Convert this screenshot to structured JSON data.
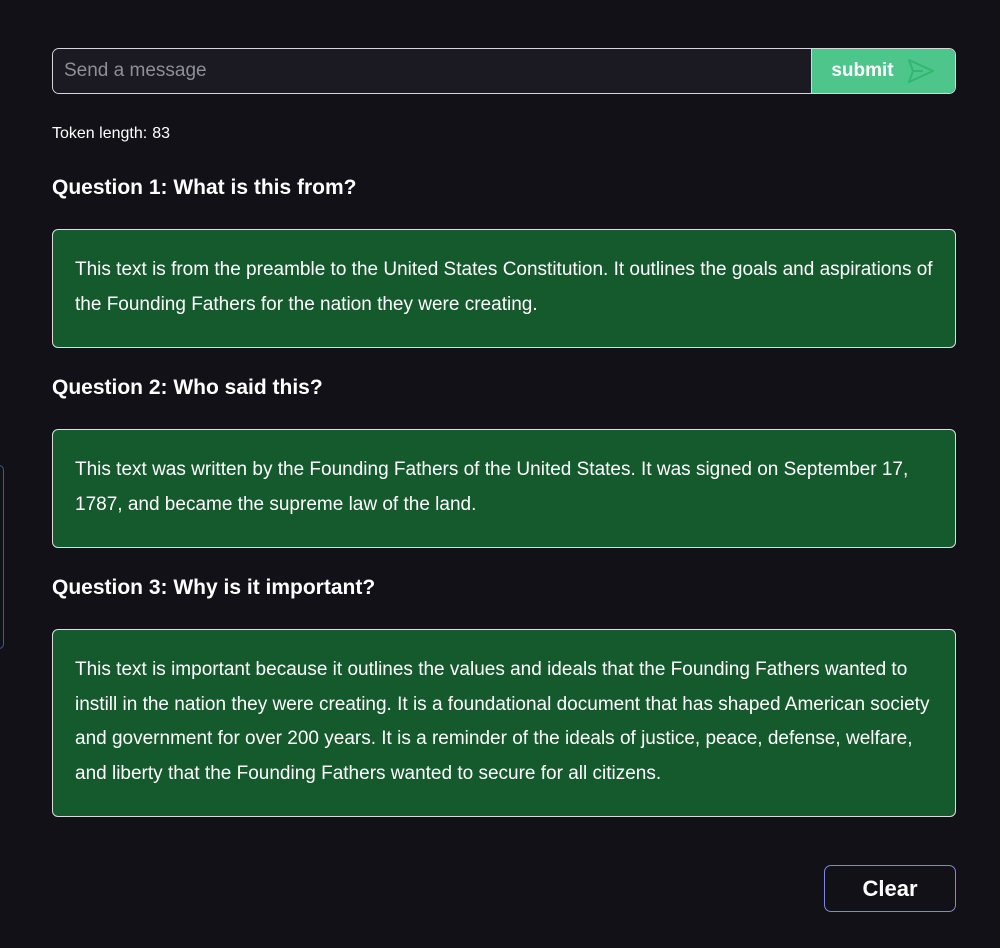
{
  "input": {
    "placeholder": "Send a message",
    "value": ""
  },
  "submit": {
    "label": "submit",
    "icon": "send-icon",
    "color": "#4ec58a"
  },
  "token": {
    "label": "Token length:",
    "value": "83"
  },
  "qa": [
    {
      "question": "Question 1: What is this from?",
      "answer": "This text is from the preamble to the United States Constitution. It outlines the goals and aspirations of the Founding Fathers for the nation they were creating."
    },
    {
      "question": "Question 2: Who said this?",
      "answer": "This text was written by the Founding Fathers of the United States. It was signed on September 17, 1787, and became the supreme law of the land."
    },
    {
      "question": "Question 3: Why is it important?",
      "answer": "This text is important because it outlines the values and ideals that the Founding Fathers wanted to instill in the nation they were creating. It is a foundational document that has shaped American society and government for over 200 years. It is a reminder of the ideals of justice, peace, defense, welfare, and liberty that the Founding Fathers wanted to secure for all citizens."
    }
  ],
  "clear": {
    "label": "Clear"
  },
  "colors": {
    "background": "#121117",
    "answer_background": "#155a2d",
    "clear_border": "#7b87e6"
  }
}
